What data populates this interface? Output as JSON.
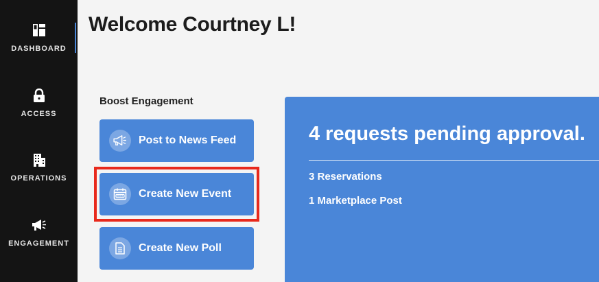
{
  "sidebar": {
    "items": [
      {
        "label": "DASHBOARD",
        "icon": "dashboard-icon",
        "active": true
      },
      {
        "label": "ACCESS",
        "icon": "lock-icon",
        "active": false
      },
      {
        "label": "OPERATIONS",
        "icon": "building-icon",
        "active": false
      },
      {
        "label": "ENGAGEMENT",
        "icon": "megaphone-icon",
        "active": false
      }
    ]
  },
  "header": {
    "title": "Welcome Courtney L!"
  },
  "boost": {
    "label": "Boost Engagement",
    "actions": [
      {
        "label": "Post to News Feed",
        "icon": "megaphone-icon"
      },
      {
        "label": "Create New Event",
        "icon": "calendar-icon",
        "highlighted": true
      },
      {
        "label": "Create New Poll",
        "icon": "document-icon"
      }
    ]
  },
  "requests": {
    "title": "4 requests pending approval.",
    "lines": [
      "3 Reservations",
      "1 Marketplace Post"
    ]
  },
  "colors": {
    "sidebar_bg": "#141414",
    "accent": "#4a86d8",
    "page_bg": "#f4f4f4",
    "highlight": "#e8291c"
  }
}
